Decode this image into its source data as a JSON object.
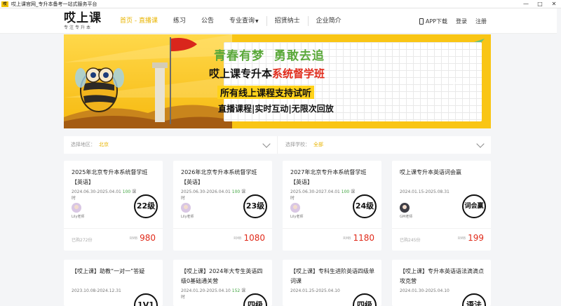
{
  "window": {
    "app_icon_text": "哎",
    "title": "哎上课官网_专升本备考一站式服务平台",
    "controls": [
      "—",
      "□",
      "✕"
    ]
  },
  "header": {
    "logo_text": "哎上课",
    "logo_slogan": "专注专升本",
    "nav": [
      {
        "label": "首页 - 直播课",
        "active": true
      },
      {
        "label": "练习"
      },
      {
        "label": "公告"
      },
      {
        "label": "专业查询",
        "dropdown": true
      },
      {
        "label": "招贤纳士"
      },
      {
        "label": "企业简介"
      }
    ],
    "app_download": "APP下载",
    "login": "登录",
    "register": "注册"
  },
  "banner": {
    "line1_part1": "青春有梦",
    "line1_part2": "勇敢去追",
    "line2_part1": "哎上课专升本",
    "line2_part2": "系统督学班",
    "line3": "所有线上课程支持试听",
    "line4": "直播课程|实时互动|无限次回放",
    "next_arrow": "›"
  },
  "filter": {
    "region_label": "选择地区：",
    "region_value": "北京",
    "school_label": "选择学校：",
    "school_value": "全部"
  },
  "courses": [
    {
      "title": "2025年北京专升本系统督学班【英语】",
      "dates": "2024.06.30-2025.04.01",
      "hours": "100",
      "hours_unit": "课时",
      "teacher": "Lily老师",
      "level": "22级",
      "sold": "已购272份",
      "rmb": "RMB",
      "price": "980"
    },
    {
      "title": "2026年北京专升本系统督学班【英语】",
      "dates": "2025.06.30-2026.04.01",
      "hours": "100",
      "hours_unit": "课时",
      "teacher": "Lily老师",
      "level": "23级",
      "sold": "",
      "rmb": "RMB",
      "price": "1080"
    },
    {
      "title": "2027年北京专升本系统督学班【英语】",
      "dates": "2025.06.30-2027.04.01",
      "hours": "100",
      "hours_unit": "课时",
      "teacher": "Lily老师",
      "level": "24级",
      "sold": "",
      "rmb": "RMB",
      "price": "1180"
    },
    {
      "title": "哎上课专升本英语词会赢",
      "dates": "2024.01.15-2025.08.31",
      "hours": "",
      "hours_unit": "",
      "teacher": "GM老师",
      "level": "词会赢",
      "sold": "已购245份",
      "rmb": "RMB",
      "price": "199"
    },
    {
      "title": "【哎上课】助教“一对一”答疑",
      "dates": "2023.10.08-2024.12.31",
      "hours": "",
      "hours_unit": "",
      "teacher": "",
      "level": "1V1",
      "sold": "",
      "rmb": "",
      "price": ""
    },
    {
      "title": "【哎上课】2024年大专生英语四级0基础通关营",
      "dates": "2024.01.20-2025.04.10",
      "hours": "152",
      "hours_unit": "课时",
      "teacher": "",
      "level": "四级",
      "sold": "",
      "rmb": "",
      "price": ""
    },
    {
      "title": "【哎上课】专科生进阶英语四级单词课",
      "dates": "2024.01.25-2025.04.10",
      "hours": "",
      "hours_unit": "",
      "teacher": "",
      "level": "四级",
      "sold": "",
      "rmb": "",
      "price": ""
    },
    {
      "title": "【哎上课】专升本英语语法滴滴点攻克营",
      "dates": "2024.01.30-2025.04.10",
      "hours": "",
      "hours_unit": "",
      "teacher": "",
      "level": "语法",
      "sold": "",
      "rmb": "",
      "price": ""
    }
  ]
}
